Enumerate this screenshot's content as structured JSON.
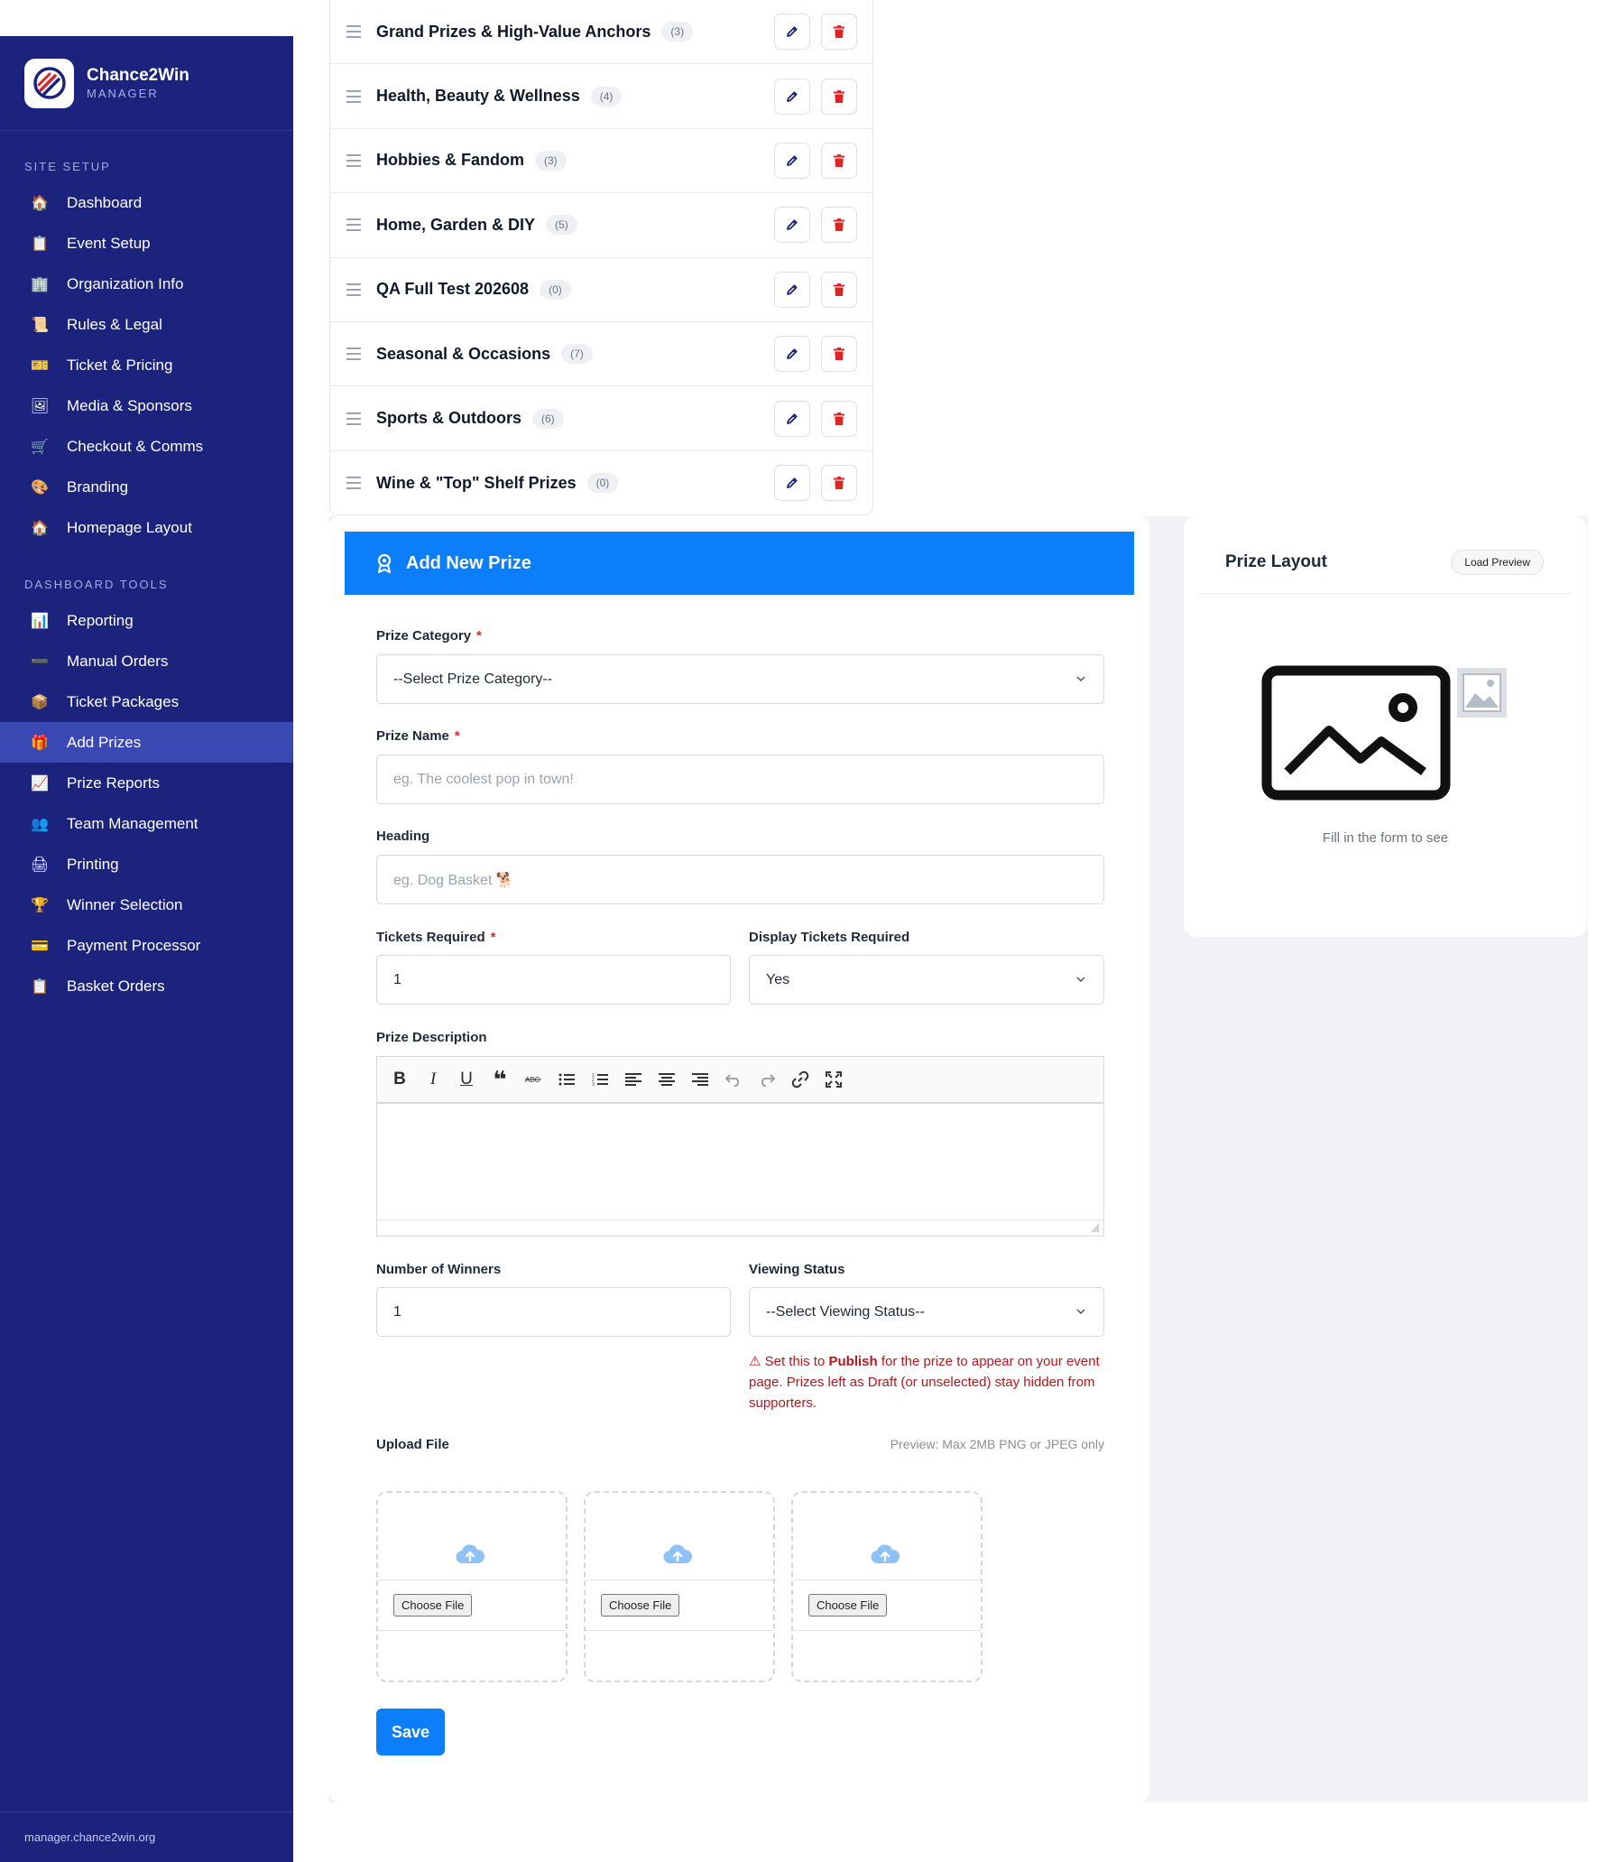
{
  "brand": {
    "name": "Chance2Win",
    "subtitle": "MANAGER"
  },
  "sidebar": {
    "section_setup": "SITE SETUP",
    "setup_items": [
      {
        "label": "Dashboard",
        "icon": "🏠"
      },
      {
        "label": "Event Setup",
        "icon": "📋"
      },
      {
        "label": "Organization Info",
        "icon": "🏢"
      },
      {
        "label": "Rules & Legal",
        "icon": "📜"
      },
      {
        "label": "Ticket & Pricing",
        "icon": "🎫"
      },
      {
        "label": "Media & Sponsors",
        "icon": "🖼"
      },
      {
        "label": "Checkout & Comms",
        "icon": "🛒"
      },
      {
        "label": "Branding",
        "icon": "🎨"
      },
      {
        "label": "Homepage Layout",
        "icon": "🏠"
      }
    ],
    "section_tools": "DASHBOARD TOOLS",
    "tool_items": [
      {
        "label": "Reporting",
        "icon": "📊"
      },
      {
        "label": "Manual Orders",
        "icon": "➖"
      },
      {
        "label": "Ticket Packages",
        "icon": "📦"
      },
      {
        "label": "Add Prizes",
        "icon": "🎁",
        "active": true
      },
      {
        "label": "Prize Reports",
        "icon": "📈"
      },
      {
        "label": "Team Management",
        "icon": "👥"
      },
      {
        "label": "Printing",
        "icon": "🖨"
      },
      {
        "label": "Winner Selection",
        "icon": "🏆"
      },
      {
        "label": "Payment Processor",
        "icon": "💳"
      },
      {
        "label": "Basket Orders",
        "icon": "📋"
      }
    ],
    "footer": "manager.chance2win.org"
  },
  "categories": [
    {
      "name": "Grand Prizes & High-Value Anchors",
      "count": "(3)"
    },
    {
      "name": "Health, Beauty & Wellness",
      "count": "(4)"
    },
    {
      "name": "Hobbies & Fandom",
      "count": "(3)"
    },
    {
      "name": "Home, Garden & DIY",
      "count": "(5)"
    },
    {
      "name": "QA Full Test 202608",
      "count": "(0)"
    },
    {
      "name": "Seasonal & Occasions",
      "count": "(7)"
    },
    {
      "name": "Sports & Outdoors",
      "count": "(6)"
    },
    {
      "name": "Wine & \"Top\" Shelf Prizes",
      "count": "(0)"
    }
  ],
  "form": {
    "title": "Add New Prize",
    "prize_category": {
      "label": "Prize Category",
      "value": "--Select Prize Category--"
    },
    "prize_name": {
      "label": "Prize Name",
      "placeholder": "eg. The coolest pop in town!"
    },
    "heading": {
      "label": "Heading",
      "placeholder": "eg. Dog Basket 🐕"
    },
    "tickets_required": {
      "label": "Tickets Required",
      "value": "1"
    },
    "display_tickets": {
      "label": "Display Tickets Required",
      "value": "Yes"
    },
    "description": {
      "label": "Prize Description"
    },
    "winners": {
      "label": "Number of Winners",
      "value": "1"
    },
    "viewing_status": {
      "label": "Viewing Status",
      "value": "--Select Viewing Status--"
    },
    "warning": {
      "prefix": "⚠ Set this to ",
      "strong": "Publish",
      "suffix": " for the prize to appear on your event page. Prizes left as Draft (or unselected) stay hidden from supporters."
    },
    "upload": {
      "label": "Upload File",
      "hint": "Preview: Max 2MB PNG or JPEG only",
      "button": "Choose File"
    },
    "save_label": "Save"
  },
  "layout_preview": {
    "title": "Prize Layout",
    "load_button": "Load Preview",
    "caption": "Fill in the form to see"
  },
  "colors": {
    "sidebar": "#1b237d",
    "sidebar_active": "#3a48b3",
    "accent": "#0d7ef9",
    "danger": "#dc2626",
    "warning_text": "#b3181d"
  }
}
